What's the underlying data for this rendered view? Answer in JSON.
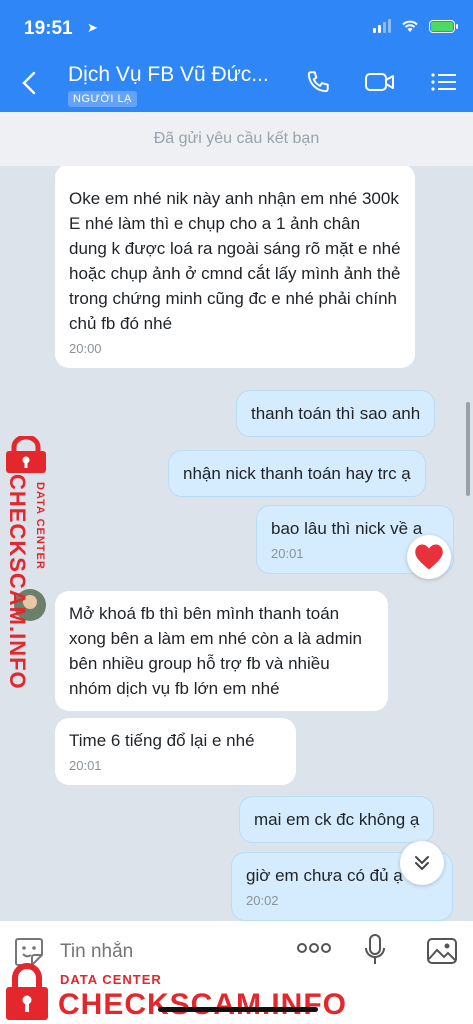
{
  "status_bar": {
    "time": "19:51"
  },
  "header": {
    "contact_name": "Dịch Vụ FB Vũ Đức...",
    "badge": "NGƯỜI LẠ"
  },
  "friend_bar": {
    "text": "Đã gửi yêu cầu kết bạn"
  },
  "messages": [
    {
      "direction": "in",
      "text": "Oke em nhé nik này anh nhận em nhé 300k E nhé làm thì e chụp cho a 1 ảnh chân dung k được loá ra ngoài sáng rõ mặt e nhé hoặc chụp ảnh ở cmnd cắt lấy mình ảnh thẻ trong chứng minh cũng đc e nhé phải  chính chủ fb đó nhé",
      "time": "20:00"
    },
    {
      "direction": "out",
      "text": "thanh toán thì sao anh"
    },
    {
      "direction": "out",
      "text": "nhận nick thanh toán hay trc ạ"
    },
    {
      "direction": "out",
      "text": "bao lâu thì nick về a",
      "time": "20:01",
      "reaction": "heart"
    },
    {
      "direction": "in",
      "text": "Mở khoá fb thì bên mình thanh toán xong bên a làm em nhé còn a là admin bên nhiều group hỗ trợ fb và nhiều nhóm dịch vụ fb lớn em nhé"
    },
    {
      "direction": "in",
      "text": "Time 6 tiếng đổ lại e nhé",
      "time": "20:01"
    },
    {
      "direction": "out",
      "text": "mai em ck đc không ạ"
    },
    {
      "direction": "out",
      "text": "giờ em chưa có đủ ạ",
      "time": "20:02"
    }
  ],
  "input": {
    "placeholder": "Tin nhắn"
  },
  "watermark": {
    "small": "DATA CENTER",
    "big": "CHECKSCAM.INFO"
  },
  "colors": {
    "header": "#2f86f6",
    "chat_bg": "#dde3ea",
    "out_bubble": "#d4ecfd",
    "watermark": "#e3272d"
  },
  "icons": [
    "back-arrow-icon",
    "phone-icon",
    "video-call-icon",
    "menu-list-icon",
    "sticker-icon",
    "more-icon",
    "microphone-icon",
    "image-icon",
    "heart-icon",
    "chevron-double-down-icon",
    "lock-icon"
  ]
}
